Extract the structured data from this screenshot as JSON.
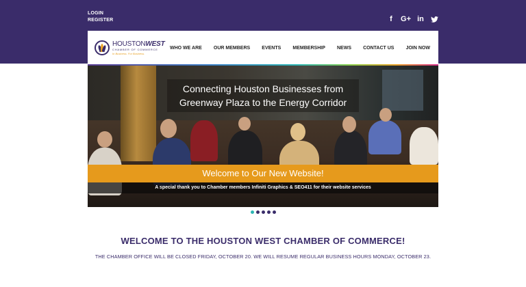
{
  "auth": {
    "login": "LOGIN",
    "register": "REGISTER"
  },
  "social": [
    {
      "icon": "facebook-icon",
      "glyph": "f"
    },
    {
      "icon": "google-plus-icon",
      "glyph": "G+"
    },
    {
      "icon": "linkedin-icon",
      "glyph": "in"
    },
    {
      "icon": "twitter-icon",
      "glyph": "🐦"
    }
  ],
  "logo": {
    "name_plain": "HOUSTON",
    "name_bold": "WEST",
    "subtitle": "CHAMBER OF COMMERCE",
    "tagline": "In Business. For Business."
  },
  "nav": {
    "items": [
      "WHO WE ARE",
      "OUR MEMBERS",
      "EVENTS",
      "MEMBERSHIP",
      "NEWS",
      "CONTACT US",
      "JOIN NOW"
    ]
  },
  "hero": {
    "headline_line1": "Connecting Houston Businesses from",
    "headline_line2": "Greenway Plaza to the Energy Corridor",
    "banner": "Welcome to Our New Website!",
    "thanks": "A special thank you to Chamber members Infiniti Graphics & SEO411 for their website services"
  },
  "slider": {
    "count": 5,
    "active_index": 0
  },
  "content": {
    "heading": "WELCOME TO THE HOUSTON WEST CHAMBER OF COMMERCE!",
    "notice": "THE CHAMBER OFFICE WILL BE CLOSED FRIDAY, OCTOBER 20. WE WILL RESUME REGULAR BUSINESS HOURS MONDAY, OCTOBER 23."
  },
  "colors": {
    "brand_purple": "#3a2c6a",
    "banner_orange": "#e69a1c",
    "accent_teal": "#2cb6b4"
  }
}
